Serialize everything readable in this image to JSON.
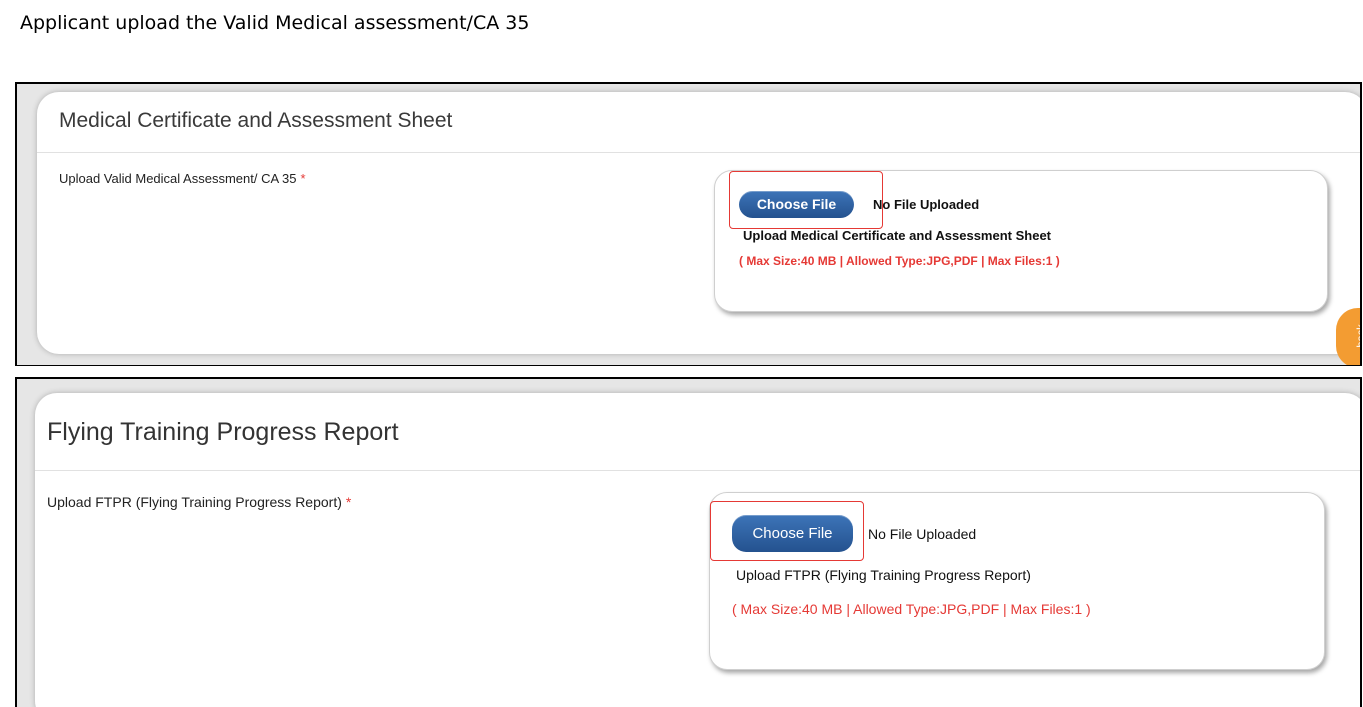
{
  "caption": "Applicant upload the Valid Medical assessment/CA  35",
  "sections": [
    {
      "title": "Medical Certificate and Assessment Sheet",
      "field_label": "Upload Valid Medical Assessment/ CA 35",
      "required_mark": "*",
      "button_label": "Choose File",
      "file_status": "No File Uploaded",
      "upload_description": "Upload Medical Certificate and Assessment Sheet",
      "upload_rules": "( Max Size:40 MB | Allowed Type:JPG,PDF | Max Files:1 )"
    },
    {
      "title": "Flying Training Progress Report",
      "field_label": "Upload FTPR (Flying Training Progress Report)",
      "required_mark": "*",
      "button_label": "Choose File",
      "file_status": "No File Uploaded",
      "upload_description": "Upload FTPR (Flying Training Progress Report)",
      "upload_rules": "( Max Size:40 MB | Allowed Type:JPG,PDF | Max Files:1 )"
    }
  ],
  "side_tab_label": "back",
  "colors": {
    "button_blue": "#2f63a5",
    "required_red": "#e53935",
    "highlight_red": "#e53935",
    "side_tab_orange": "#f39c32"
  }
}
